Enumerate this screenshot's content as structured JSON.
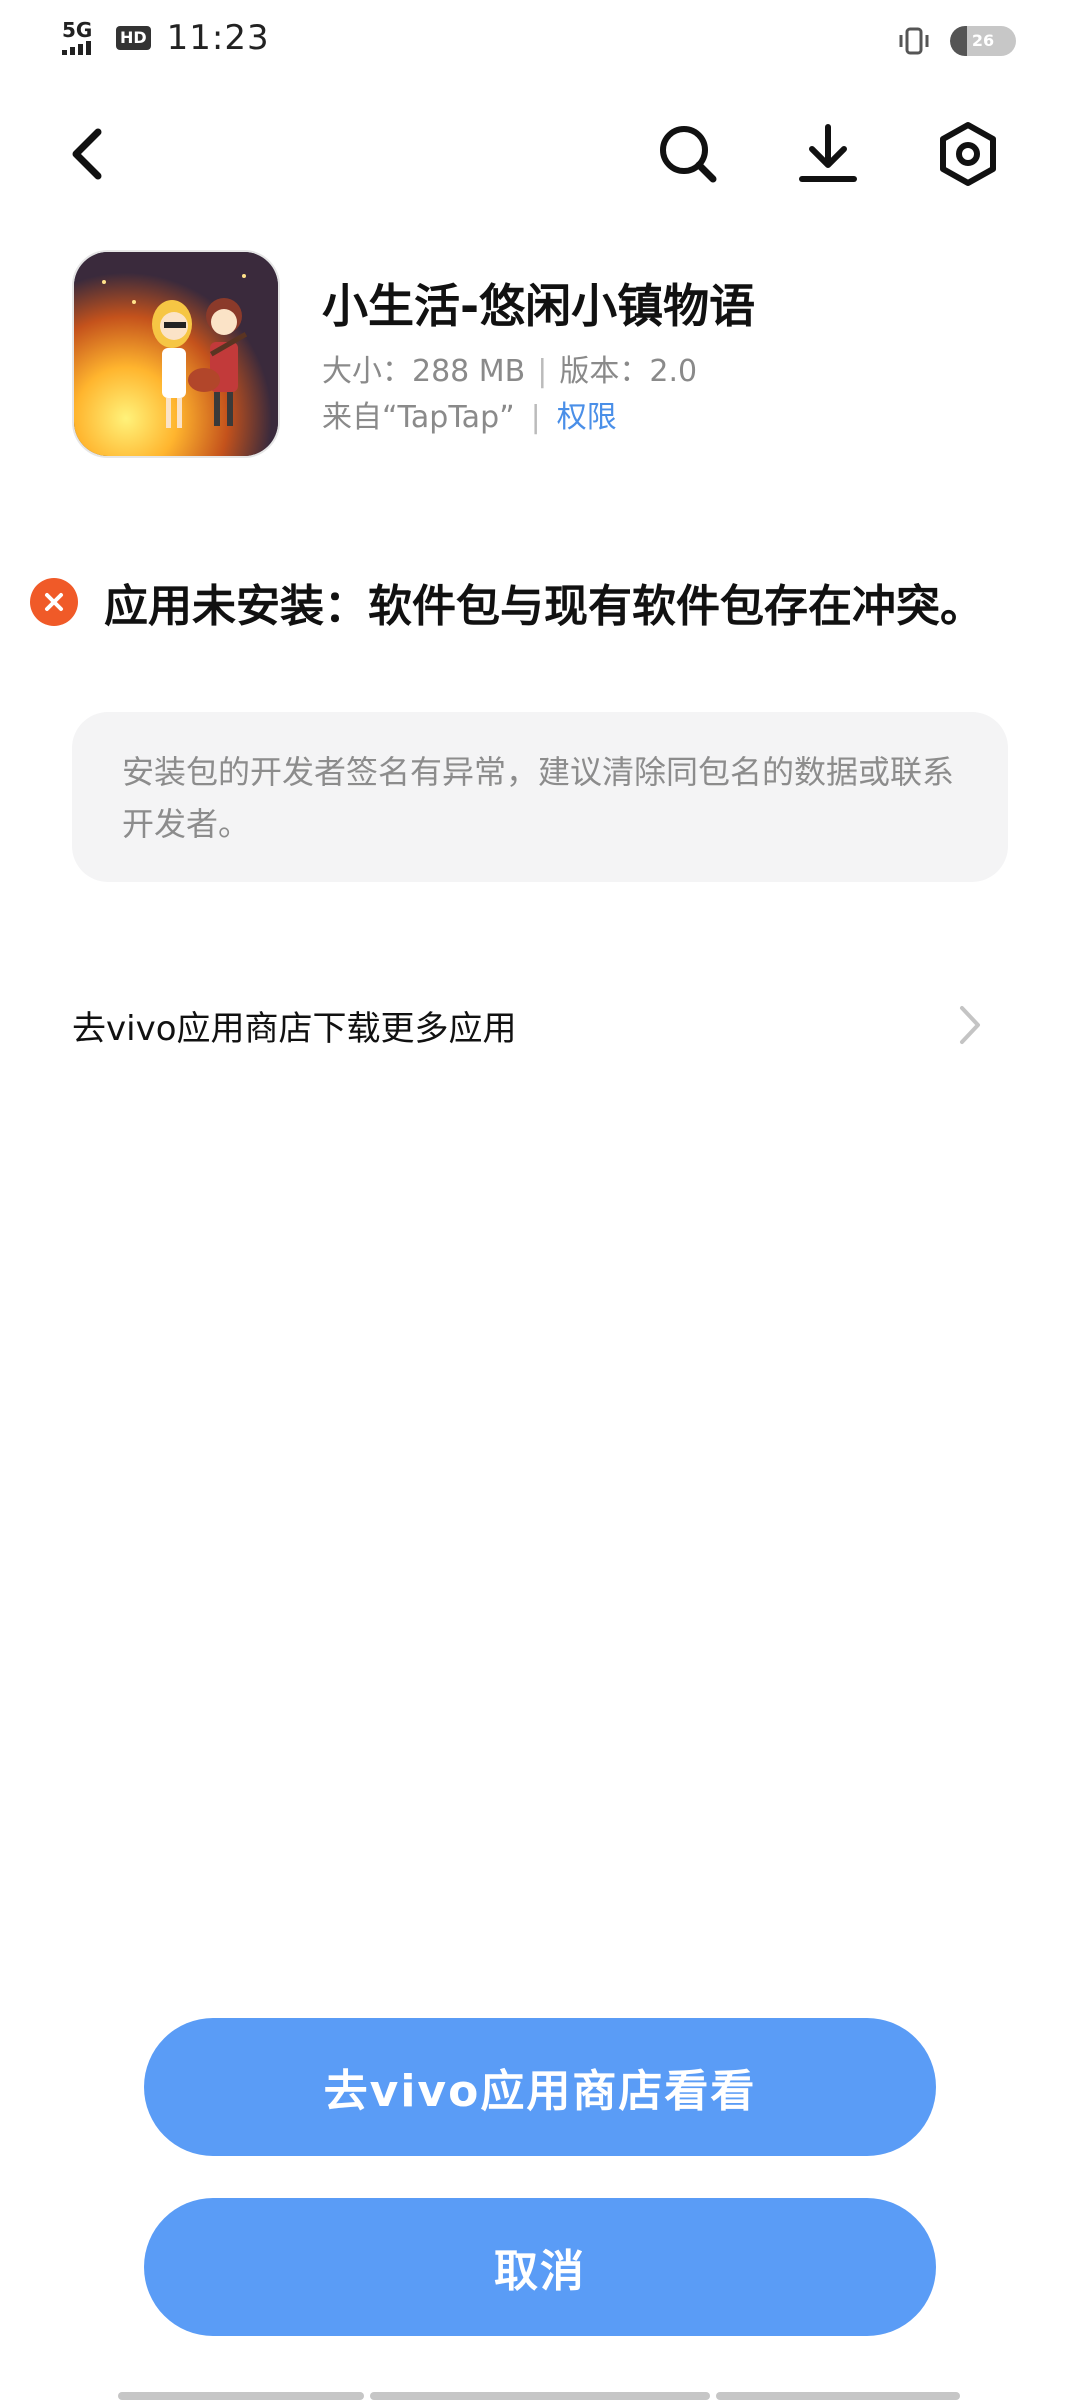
{
  "status_bar": {
    "network": "5G",
    "hd": "HD",
    "time": "11:23",
    "battery_level": "26",
    "battery_fraction": 0.26
  },
  "nav": {
    "back_icon": "back-arrow-icon",
    "search_icon": "search-icon",
    "download_icon": "download-icon",
    "settings_icon": "settings-hex-icon"
  },
  "app": {
    "name": "小生活-悠闲小镇物语",
    "size": "大小：288 MB",
    "version": "版本：2.0",
    "source": "来自“TapTap”",
    "permissions": "权限"
  },
  "error": {
    "icon": "error-close-icon",
    "message": "应用未安装：软件包与现有软件包存在冲突。"
  },
  "hint": {
    "text": "安装包的开发者签名有异常，建议清除同包名的数据或联系开发者。"
  },
  "store_link": {
    "label": "去vivo应用商店下载更多应用",
    "chevron_icon": "chevron-right-icon"
  },
  "buttons": {
    "store": "去vivo应用商店看看",
    "cancel": "取消"
  },
  "colors": {
    "accent": "#5a9cf6",
    "link": "#4a8fe8",
    "error": "#f05a28"
  }
}
